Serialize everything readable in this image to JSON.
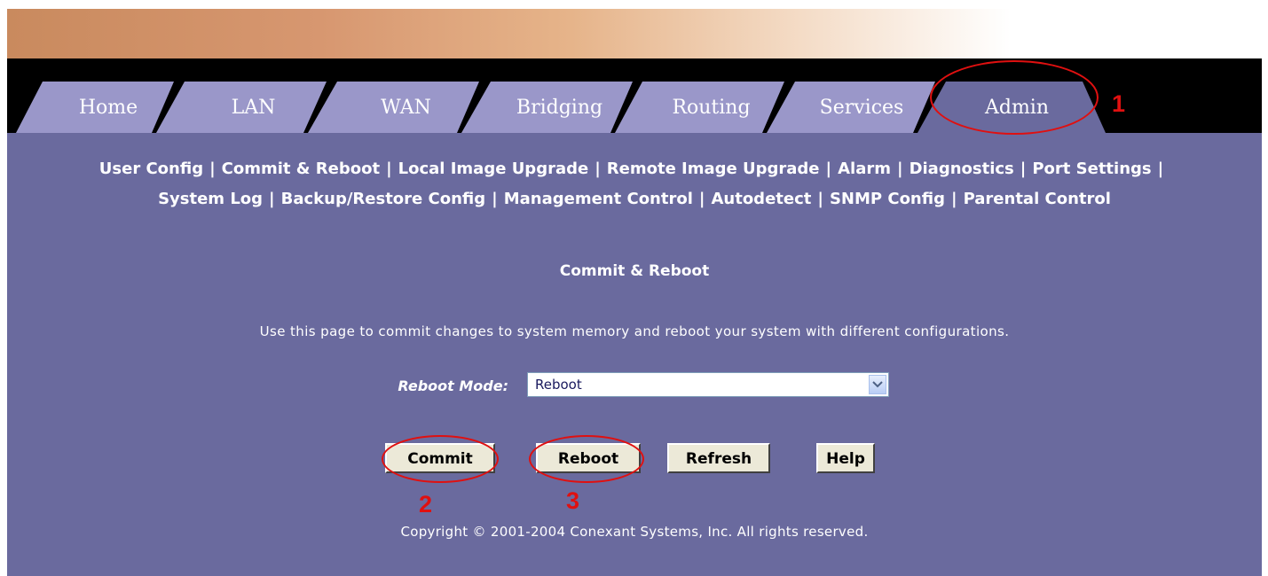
{
  "tabs": [
    {
      "label": "Home"
    },
    {
      "label": "LAN"
    },
    {
      "label": "WAN"
    },
    {
      "label": "Bridging"
    },
    {
      "label": "Routing"
    },
    {
      "label": "Services"
    },
    {
      "label": "Admin",
      "active": true
    }
  ],
  "subnav": {
    "line1": [
      "User Config",
      "Commit & Reboot",
      "Local Image Upgrade",
      "Remote Image Upgrade",
      "Alarm",
      "Diagnostics",
      "Port Settings"
    ],
    "line2": [
      "System Log",
      "Backup/Restore Config",
      "Management Control",
      "Autodetect",
      "SNMP Config",
      "Parental Control"
    ],
    "separator": "|"
  },
  "page": {
    "title": "Commit & Reboot",
    "description": "Use this page to commit changes to system memory and reboot your system with different configurations.",
    "reboot_mode_label": "Reboot Mode:",
    "reboot_mode_value": "Reboot"
  },
  "buttons": {
    "commit": "Commit",
    "reboot": "Reboot",
    "refresh": "Refresh",
    "help": "Help"
  },
  "copyright": "Copyright © 2001-2004 Conexant Systems, Inc. All rights reserved.",
  "annotations": {
    "step1": "1",
    "step2": "2",
    "step3": "3",
    "color": "#e01010"
  },
  "colors": {
    "content_bg": "#6a6a9e",
    "tab_inactive": "#9a97c9",
    "tab_active": "#6a6a9e",
    "tabbar_bg": "#000000"
  },
  "icons": {
    "select_arrow": "chevron-down-icon"
  }
}
